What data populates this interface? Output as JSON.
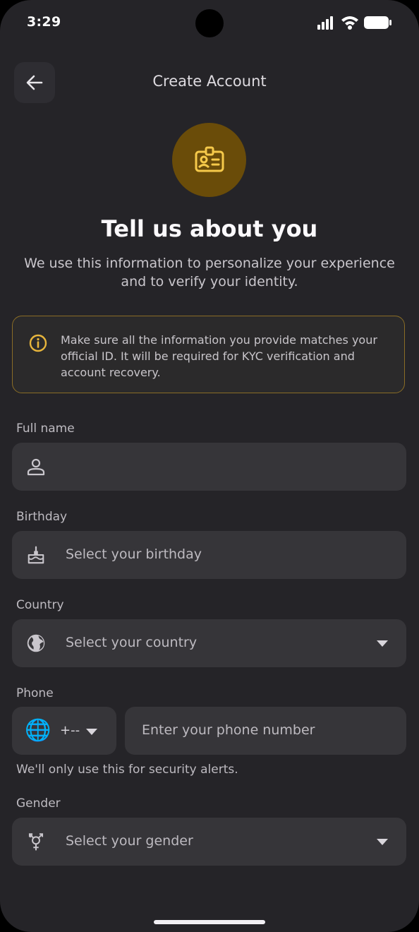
{
  "status": {
    "time": "3:29"
  },
  "header": {
    "title": "Create Account"
  },
  "hero": {
    "icon": "id-badge-icon",
    "accent": "#6a4c09",
    "heading": "Tell us about you",
    "subtitle": "We use this information to personalize your experience and to verify your identity."
  },
  "notice": {
    "icon": "info-icon",
    "border_color": "#8a6d26",
    "text": "Make sure all the information you provide matches your official ID. It will be required for KYC verification and account recovery."
  },
  "form": {
    "full_name": {
      "label": "Full name",
      "value": "",
      "icon": "person-icon"
    },
    "birthday": {
      "label": "Birthday",
      "placeholder": "Select your birthday",
      "icon": "cake-icon"
    },
    "country": {
      "label": "Country",
      "placeholder": "Select your country",
      "icon": "globe-icon"
    },
    "phone": {
      "label": "Phone",
      "country_code": "+--",
      "code_icon": "globe-emoji",
      "placeholder": "Enter your phone number",
      "hint": "We'll only use this for security alerts."
    },
    "gender": {
      "label": "Gender",
      "placeholder": "Select your gender",
      "icon": "gender-icon"
    }
  }
}
